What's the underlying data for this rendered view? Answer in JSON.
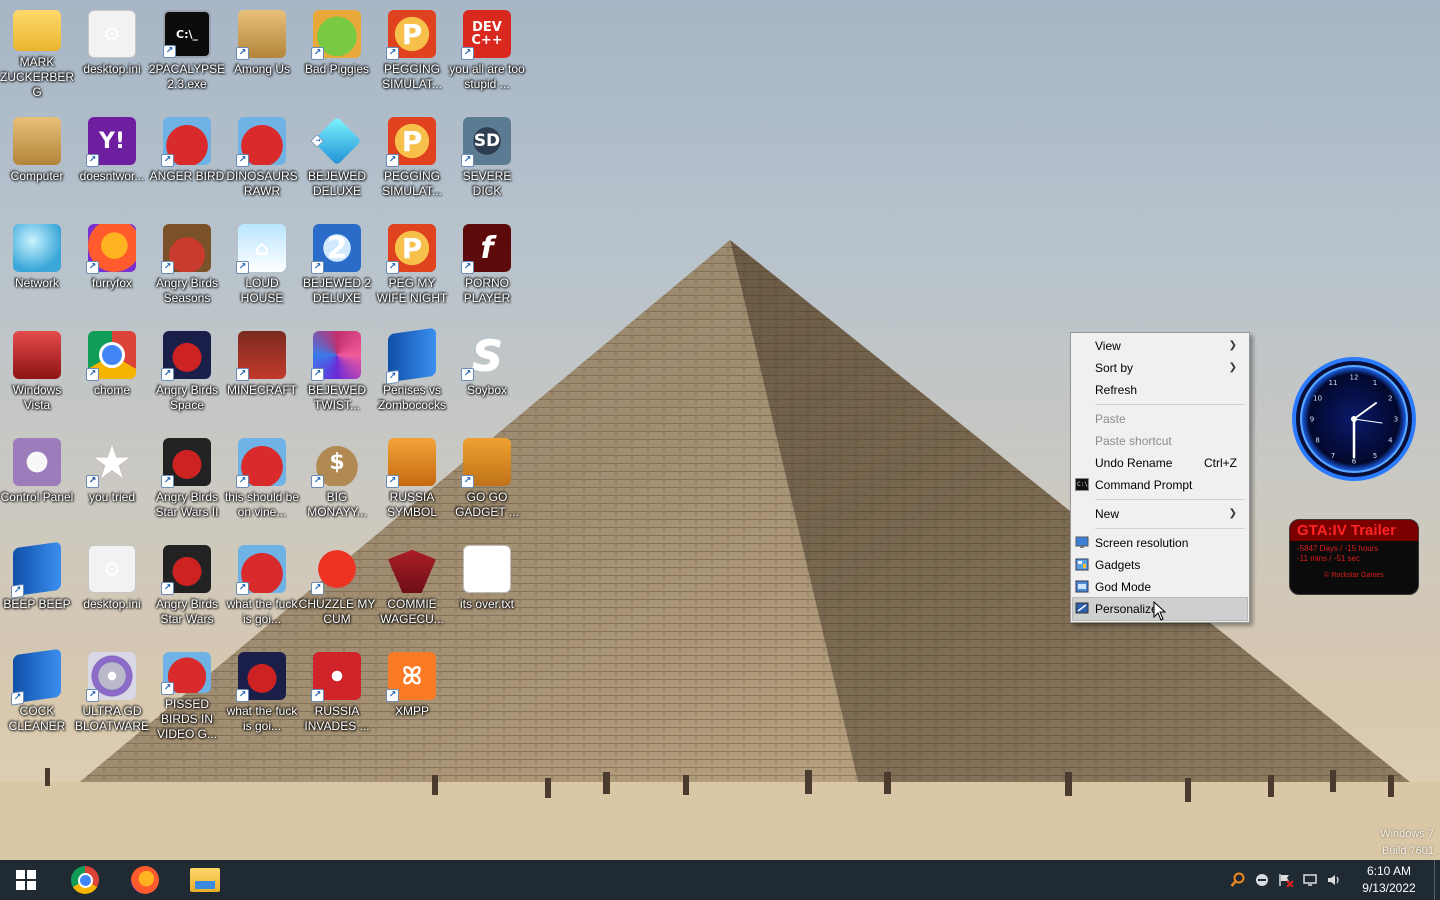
{
  "desktop": {
    "icons": [
      {
        "label": "MARK ZUCKERBERG",
        "icon": "folder-icon"
      },
      {
        "label": "desktop.ini",
        "icon": "settings-file-icon"
      },
      {
        "label": "2PACALYPSE 2.3.exe",
        "icon": "cmd-icon"
      },
      {
        "label": "Among Us",
        "icon": "among-us-icon"
      },
      {
        "label": "Bad Piggies",
        "icon": "bad-piggies-icon"
      },
      {
        "label": "PEGGING SIMULAT...",
        "icon": "pegging-icon"
      },
      {
        "label": "you all are too stupid ...",
        "icon": "devcpp-icon"
      },
      {
        "label": "Computer",
        "icon": "computer-icon"
      },
      {
        "label": "doesntwor...",
        "icon": "yahoo-icon"
      },
      {
        "label": "ANGER BIRD",
        "icon": "angry-bird-icon"
      },
      {
        "label": "DINOSAURS RAWR",
        "icon": "angry-bird-icon"
      },
      {
        "label": "BEJEWED DELUXE",
        "icon": "gem-icon"
      },
      {
        "label": "PEGGING SIMULAT...",
        "icon": "pegging-icon"
      },
      {
        "label": "SEVERE DICK",
        "icon": "sd-gear-icon"
      },
      {
        "label": "Network",
        "icon": "network-icon"
      },
      {
        "label": "furryfox",
        "icon": "firefox-icon"
      },
      {
        "label": "Angry Birds Seasons",
        "icon": "angry-birds-seasons-icon"
      },
      {
        "label": "LOUD HOUSE",
        "icon": "loud-house-icon"
      },
      {
        "label": "BEJEWED 2 DELUXE",
        "icon": "bejeweled-2-icon"
      },
      {
        "label": "PEG MY WIFE NIGHT",
        "icon": "pegging-icon"
      },
      {
        "label": "PORNO PLAYER",
        "icon": "flash-icon"
      },
      {
        "label": "Windows Vista",
        "icon": "recycle-bin-icon"
      },
      {
        "label": "chome",
        "icon": "chrome-icon"
      },
      {
        "label": "Angry Birds Space",
        "icon": "angry-birds-space-icon"
      },
      {
        "label": "MINECRAFT",
        "icon": "minecraft-icon"
      },
      {
        "label": "BEJEWED TWIST...",
        "icon": "bejeweled-twist-icon"
      },
      {
        "label": "Penises vs Zombococks",
        "icon": "blue-door-icon"
      },
      {
        "label": "Soybox",
        "icon": "soybox-icon"
      },
      {
        "label": "Control Panel",
        "icon": "control-panel-icon"
      },
      {
        "label": "you tried",
        "icon": "star-icon"
      },
      {
        "label": "Angry Birds Star Wars II",
        "icon": "angry-birds-star-wars-icon"
      },
      {
        "label": "this should be on vine...",
        "icon": "angry-bird-icon"
      },
      {
        "label": "BIG MONAYY...",
        "icon": "money-bag-icon"
      },
      {
        "label": "RUSSIA SYMBOL",
        "icon": "russia-symbol-icon"
      },
      {
        "label": "GO GO GADGET ...",
        "icon": "briefcase-icon"
      },
      {
        "label": "BEEP BEEP",
        "icon": "blue-door-icon"
      },
      {
        "label": "desktop.ini",
        "icon": "settings-file-icon"
      },
      {
        "label": "Angry Birds Star Wars",
        "icon": "angry-birds-star-wars-icon"
      },
      {
        "label": "what the fuck is goi...",
        "icon": "angry-bird-icon"
      },
      {
        "label": "CHUZZLE MY CUM",
        "icon": "chuzzle-icon"
      },
      {
        "label": "COMMIE WAGECU...",
        "icon": "eagle-icon"
      },
      {
        "label": "its over.txt",
        "icon": "text-file-icon"
      },
      {
        "label": "COCK CLEANER",
        "icon": "blue-door-icon"
      },
      {
        "label": "ULTRA GD BLOATWARE",
        "icon": "disc-icon"
      },
      {
        "label": "PISSED BIRDS IN VIDEO G...",
        "icon": "angry-bird-icon"
      },
      {
        "label": "what the fuck is goi...",
        "icon": "angry-birds-space-icon"
      },
      {
        "label": "RUSSIA INVADES ...",
        "icon": "radiation-icon"
      },
      {
        "label": "XMPP",
        "icon": "xampp-icon"
      }
    ]
  },
  "context_menu": {
    "items": [
      {
        "label": "View",
        "submenu": true
      },
      {
        "label": "Sort by",
        "submenu": true
      },
      {
        "label": "Refresh"
      },
      {
        "label": "Paste",
        "disabled": true
      },
      {
        "label": "Paste shortcut",
        "disabled": true
      },
      {
        "label": "Undo Rename",
        "shortcut": "Ctrl+Z"
      },
      {
        "label": "Command Prompt",
        "icon": "cmd-icon"
      },
      {
        "label": "New",
        "submenu": true
      },
      {
        "label": "Screen resolution",
        "icon": "screen-resolution-icon"
      },
      {
        "label": "Gadgets",
        "icon": "gadgets-icon"
      },
      {
        "label": "God Mode",
        "icon": "god-mode-icon"
      },
      {
        "label": "Personalize",
        "icon": "personalize-icon",
        "hover": true
      }
    ]
  },
  "gadgets": {
    "clock": {
      "numerals": [
        "12",
        "1",
        "2",
        "3",
        "4",
        "5",
        "6",
        "7",
        "8",
        "9",
        "10",
        "11"
      ]
    },
    "gta": {
      "title": "GTA:IV  Trailer",
      "line1": "-5847 Days / -15 hours",
      "line2": "-11 mins / -51 sec",
      "footer": "© Rockstar Games"
    }
  },
  "watermark": {
    "line1": "Windows 7",
    "line2": "Build 7601"
  },
  "taskbar": {
    "pinned": [
      "chrome-icon",
      "firefox-icon",
      "file-explorer-icon"
    ],
    "tray_icons": [
      "search-icon",
      "network-globe-icon",
      "action-center-flag-icon",
      "display-icon",
      "volume-icon"
    ],
    "time": "6:10 AM",
    "date": "9/13/2022"
  },
  "colors": {
    "taskbar": "#1f2a33",
    "menu_bg": "#f0f0f0",
    "menu_hover": "#cfcfcf",
    "gta_red": "#ff2424",
    "clock_blue": "#1e6bff"
  }
}
